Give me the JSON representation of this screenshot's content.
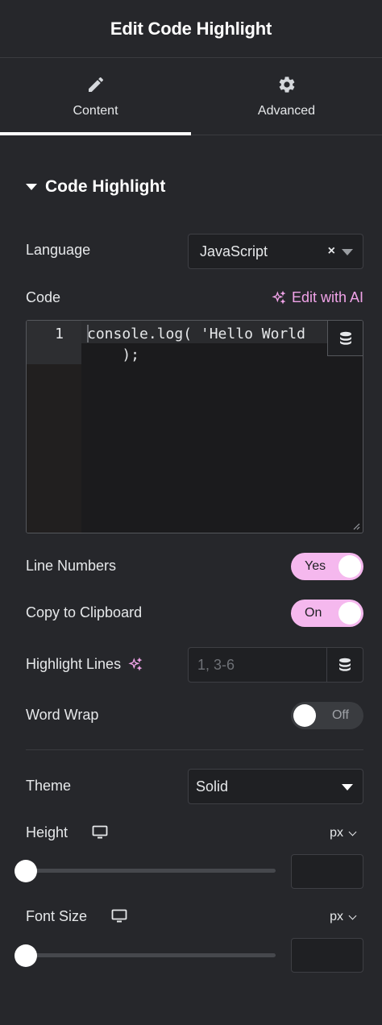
{
  "header": {
    "title": "Edit Code Highlight"
  },
  "tabs": [
    {
      "label": "Content",
      "icon": "pencil-icon",
      "active": true
    },
    {
      "label": "Advanced",
      "icon": "gear-icon",
      "active": false
    }
  ],
  "section": {
    "title": "Code Highlight"
  },
  "language": {
    "label": "Language",
    "value": "JavaScript",
    "clear": "×"
  },
  "code": {
    "label": "Code",
    "ai_link": "Edit with AI",
    "line_number": "1",
    "content": "console.log( 'Hello World\n    );"
  },
  "line_numbers": {
    "label": "Line Numbers",
    "value": "Yes",
    "on": true
  },
  "copy_clipboard": {
    "label": "Copy to Clipboard",
    "value": "On",
    "on": true
  },
  "highlight_lines": {
    "label": "Highlight Lines",
    "placeholder": "1, 3-6"
  },
  "word_wrap": {
    "label": "Word Wrap",
    "value": "Off",
    "on": false
  },
  "theme": {
    "label": "Theme",
    "value": "Solid"
  },
  "height": {
    "label": "Height",
    "unit": "px",
    "slider_value": 0
  },
  "font_size": {
    "label": "Font Size",
    "unit": "px",
    "slider_value": 0
  },
  "colors": {
    "accent": "#f5b8ee",
    "ai": "#f0a3e8",
    "background": "#26272b"
  }
}
